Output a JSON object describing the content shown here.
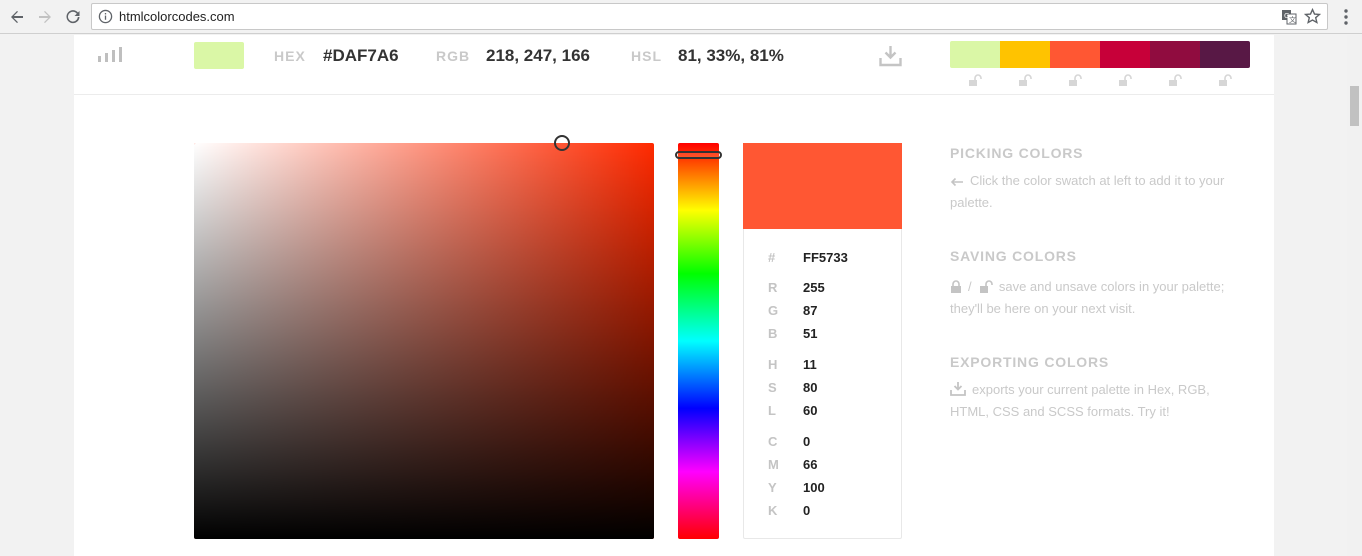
{
  "browser": {
    "url": "htmlcolorcodes.com"
  },
  "current": {
    "hex_label": "HEX",
    "hex_value": "#DAF7A6",
    "rgb_label": "RGB",
    "rgb_value": "218, 247, 166",
    "hsl_label": "HSL",
    "hsl_value": "81, 33%, 81%",
    "swatch_color": "#DAF7A6"
  },
  "palette": [
    "#DAF7A6",
    "#FFC300",
    "#FF5733",
    "#C70039",
    "#900C3F",
    "#581845"
  ],
  "picker": {
    "hue_color": "#FF2A00",
    "preview_color": "#FF5733",
    "rows": [
      {
        "k": "#",
        "v": "FF5733"
      },
      {
        "k": "R",
        "v": "255"
      },
      {
        "k": "G",
        "v": "87"
      },
      {
        "k": "B",
        "v": "51"
      },
      {
        "k": "H",
        "v": "11"
      },
      {
        "k": "S",
        "v": "80"
      },
      {
        "k": "L",
        "v": "60"
      },
      {
        "k": "C",
        "v": "0"
      },
      {
        "k": "M",
        "v": "66"
      },
      {
        "k": "Y",
        "v": "100"
      },
      {
        "k": "K",
        "v": "0"
      }
    ]
  },
  "help": {
    "picking_title": "PICKING COLORS",
    "picking_text": "Click the color swatch at left to add it to your palette.",
    "saving_title": "SAVING COLORS",
    "saving_slash": "/",
    "saving_text": "save and unsave colors in your palette; they'll be here on your next visit.",
    "exporting_title": "EXPORTING COLORS",
    "exporting_text": "exports your current palette in Hex, RGB, HTML, CSS and SCSS formats. Try it!"
  }
}
